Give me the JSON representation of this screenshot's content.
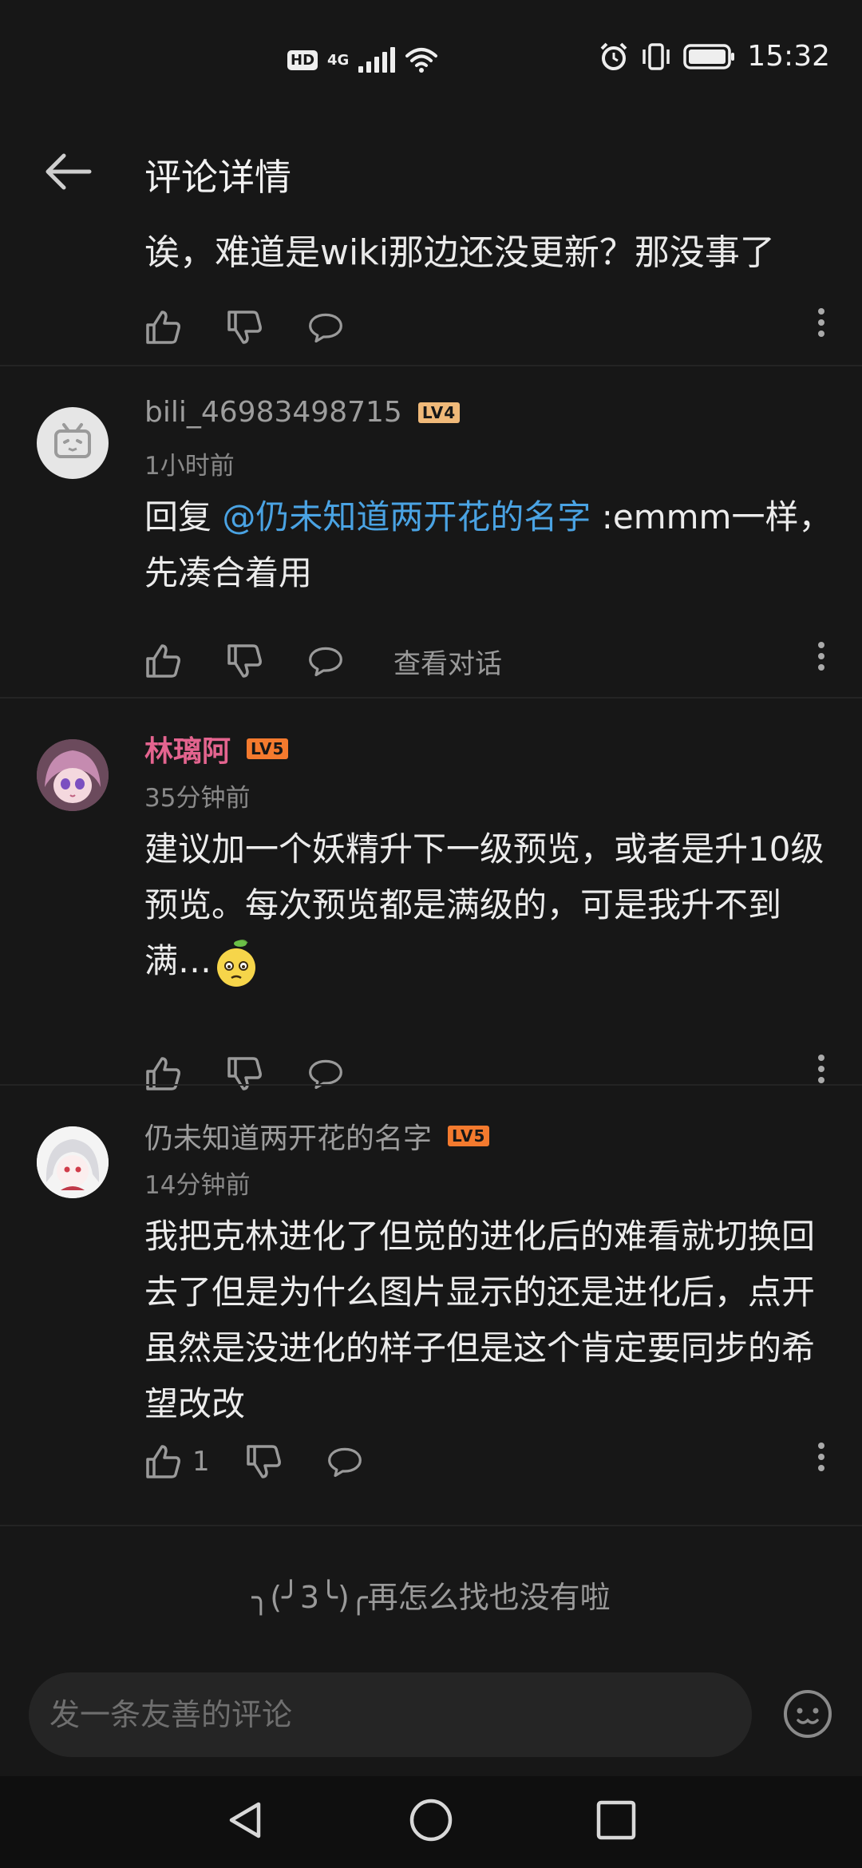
{
  "status_bar": {
    "hd_label": "HD",
    "network_label": "4G",
    "time": "15:32"
  },
  "header": {
    "title": "评论详情"
  },
  "previous_comment": {
    "text_tail": "诶，难道是wiki那边还没更新？那没事了"
  },
  "comments": [
    {
      "username": "bili_46983498715",
      "level": "LV4",
      "time": "1小时前",
      "reply_prefix": "回复 ",
      "mention": "@仍未知道两开花的名字",
      "text": " :emmm一样，先凑合着用",
      "view_conversation": "查看对话"
    },
    {
      "username": "林璃阿",
      "level": "LV5",
      "time": "35分钟前",
      "text": "建议加一个妖精升下一级预览，或者是升10级预览。每次预览都是满级的，可是我升不到满…"
    },
    {
      "username": "仍未知道两开花的名字",
      "level": "LV5",
      "time": "14分钟前",
      "text": "我把克林进化了但觉的进化后的难看就切换回去了但是为什么图片显示的还是进化后，点开虽然是没进化的样子但是这个肯定要同步的希望改改",
      "like_count": "1"
    }
  ],
  "end_tip": "╮(╯3╰)╭再怎么找也没有啦",
  "input": {
    "placeholder": "发一条友善的评论"
  },
  "colors": {
    "background": "#171717",
    "mention": "#4aa3e3",
    "vip_name": "#e4648f",
    "lv4_badge": "#f0b979",
    "lv5_badge": "#f47a2e"
  }
}
